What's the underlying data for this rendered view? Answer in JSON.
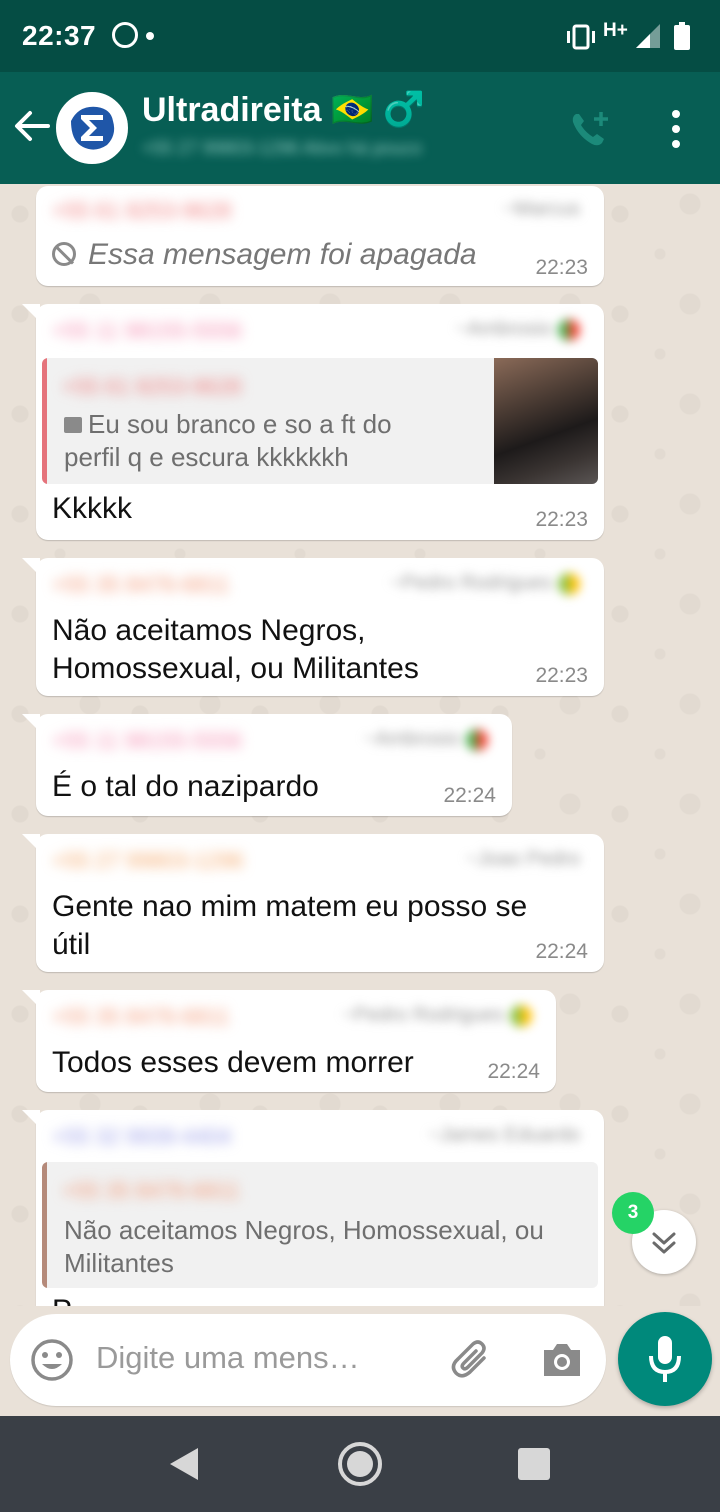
{
  "status_bar": {
    "time": "22:37",
    "network": "H+"
  },
  "header": {
    "title": "Ultradireita 🇧🇷 ♂️",
    "subtitle": "+55 27 99803-1296 Ativo há pouco",
    "icons": [
      "back-arrow-icon",
      "group-avatar",
      "add-call-icon",
      "more-vert-icon"
    ]
  },
  "messages": [
    {
      "sender": "+55 61 8253-9628",
      "sender_color": "#f08080",
      "push_name": "~Marcus",
      "deleted": true,
      "text": "Essa mensagem foi apagada",
      "time": "22:23"
    },
    {
      "sender": "+55 11 98155-5556",
      "sender_color": "#f58fb2",
      "push_name": "~Ambrosio",
      "quote": {
        "sender": "+55 61 8253-9628",
        "sender_color": "#f08080",
        "bar_color": "#e5737b",
        "text_line1": "Eu sou branco e so a ft do",
        "text_line2": "perfil q e escura kkkkkkh",
        "has_thumbnail": true
      },
      "text": "Kkkkk",
      "time": "22:23"
    },
    {
      "sender": "+55 35 8476-6811",
      "sender_color": "#f39b7a",
      "push_name": "~Pedro Rodrigues",
      "text_line1": "Não aceitamos Negros,",
      "text_line2": "Homossexual, ou Militantes",
      "time": "22:23"
    },
    {
      "sender": "+55 11 98155-5556",
      "sender_color": "#f58fb2",
      "push_name": "~Ambrosio",
      "text": "É o tal do nazipardo",
      "time": "22:24"
    },
    {
      "sender": "+55 27 99803-1296",
      "sender_color": "#f5a86a",
      "push_name": "~Joao Pedro",
      "text_line1": "Gente nao mim matem eu posso se",
      "text_line2": "útil",
      "time": "22:24"
    },
    {
      "sender": "+55 35 8476-6811",
      "sender_color": "#f39b7a",
      "push_name": "~Pedro Rodrigues",
      "text": "Todos esses devem morrer",
      "time": "22:24"
    },
    {
      "sender": "+55 32 9939-4404",
      "sender_color": "#9a9ee8",
      "push_name": "~James Eduardo",
      "quote": {
        "sender": "+55 35 8476-6811",
        "sender_color": "#f39b7a",
        "bar_color": "#b58a7a",
        "text_line1": "Não aceitamos Negros, Homossexual, ou",
        "text_line2": "Militantes"
      },
      "text": "P"
    }
  ],
  "scroll_button": {
    "unread_count": "3"
  },
  "composer": {
    "placeholder": "Digite uma mens…"
  },
  "colors": {
    "header_bg": "#075e54",
    "status_bg": "#054d44",
    "mic_bg": "#00897b",
    "badge_bg": "#25d366",
    "chat_bg": "#e9e1d8"
  }
}
